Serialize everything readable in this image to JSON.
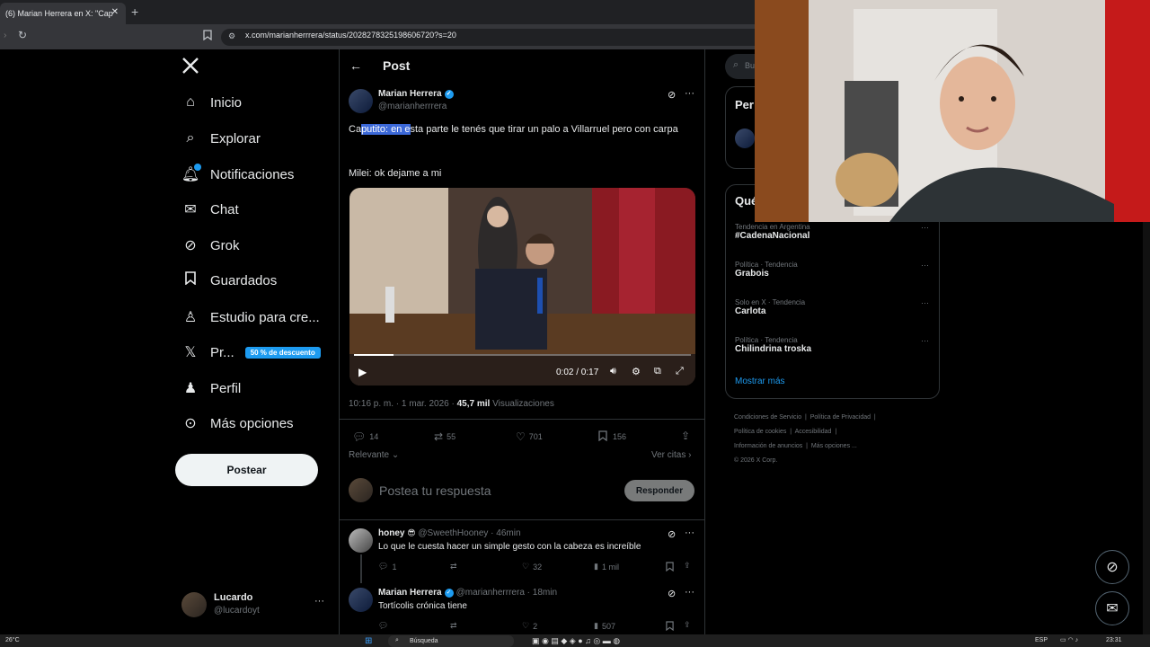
{
  "browser": {
    "tab_title": "(6) Marian Herrera en X: \"Cap",
    "url": "x.com/marianherrrera/status/2028278325198606720?s=20"
  },
  "nav": {
    "items": [
      {
        "label": "Inicio",
        "icon": "home-icon"
      },
      {
        "label": "Explorar",
        "icon": "search-icon"
      },
      {
        "label": "Notificaciones",
        "icon": "bell-icon"
      },
      {
        "label": "Chat",
        "icon": "mail-icon"
      },
      {
        "label": "Grok",
        "icon": "grok-icon"
      },
      {
        "label": "Guardados",
        "icon": "bookmark-icon"
      },
      {
        "label": "Estudio para cre...",
        "icon": "creator-studio-icon"
      },
      {
        "label": "Pr...",
        "icon": "x-icon"
      },
      {
        "label": "Perfil",
        "icon": "person-icon"
      },
      {
        "label": "Más opciones",
        "icon": "more-circle-icon"
      }
    ],
    "premium_badge": "50 % de descuento",
    "post_button": "Postear",
    "account": {
      "name": "Lucardo",
      "handle": "@lucardoyt"
    }
  },
  "post": {
    "header_title": "Post",
    "author_name": "Marian Herrera",
    "author_handle": "@marianherrrera",
    "text_selected": "putito: en e",
    "text_pre": "Ca",
    "text_post": "sta parte le tenés que tirar un palo a Villarruel pero con carpa",
    "text_line2": "Milei: ok dejame a mi",
    "video_time": "0:02 / 0:17",
    "video_progress": 0.118,
    "timestamp": "10:16 p. m. · 1 mar. 2026 · ",
    "views_count": "45,7 mil",
    "views_label": " Visualizaciones",
    "replies": "14",
    "reposts": "55",
    "likes": "701",
    "bookmarks": "156",
    "sort_label": "Relevante",
    "quotes_label": "Ver citas",
    "reply_placeholder": "Postea tu respuesta",
    "reply_button": "Responder"
  },
  "replies": [
    {
      "name": "honey",
      "handle": "@SweethHooney · 46min",
      "text": "Lo que le cuesta hacer un simple gesto con la cabeza es increíble",
      "replies": "1",
      "reposts": "",
      "likes": "32",
      "views": "1 mil"
    },
    {
      "name": "Marian Herrera",
      "handle": "@marianherrrera · 18min",
      "text": "Tortícolis crónica tiene",
      "replies": "",
      "reposts": "",
      "likes": "2",
      "views": "507"
    }
  ],
  "right": {
    "search_placeholder": "Bu",
    "card1_title": "Per",
    "card2_title": "Qué",
    "trends": [
      {
        "meta": "Tendencia en Argentina",
        "name": "#CadenaNacional"
      },
      {
        "meta": "Política · Tendencia",
        "name": "Grabois"
      },
      {
        "meta": "Solo en X · Tendencia",
        "name": "Carlota"
      },
      {
        "meta": "Política · Tendencia",
        "name": "Chilindrina troska"
      }
    ],
    "show_more": "Mostrar más",
    "footer": [
      "Condiciones de Servicio",
      "Política de Privacidad",
      "Política de cookies",
      "Accesibilidad",
      "Información de anuncios",
      "Más opciones ...",
      "© 2026 X Corp."
    ]
  },
  "taskbar": {
    "weather": "26°C",
    "search": "Búsqueda",
    "lang": "ESP",
    "time": "23:31"
  },
  "colors": {
    "accent": "#1d9bf0",
    "selection": "#3b68d8"
  }
}
